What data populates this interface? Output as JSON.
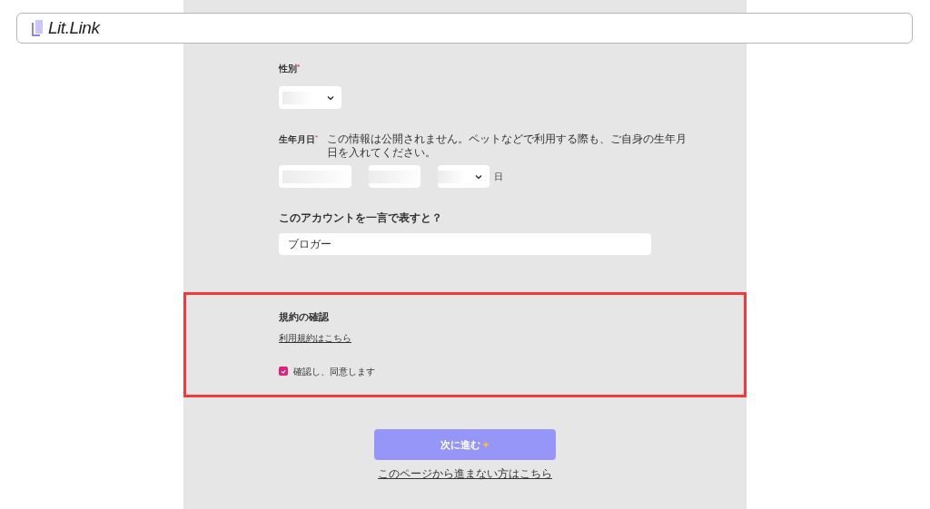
{
  "header": {
    "logo": "Lit.Link"
  },
  "gender": {
    "label": "性別",
    "required_mark": "*"
  },
  "birthday": {
    "label": "生年月日",
    "required_mark": "*",
    "note": "この情報は公開されません。ペットなどで利用する際も、ご自身の生年月日を入れてください。",
    "day_unit": "日"
  },
  "account": {
    "label": "このアカウントを一言で表すと？",
    "value": "ブロガー"
  },
  "terms": {
    "title": "規約の確認",
    "link": "利用規約はこちら",
    "agree_label": "確認し、同意します",
    "checked": true,
    "highlighted": true
  },
  "next_button": {
    "label": "次に進む"
  },
  "help_link": "このページから進まない方はこちら"
}
